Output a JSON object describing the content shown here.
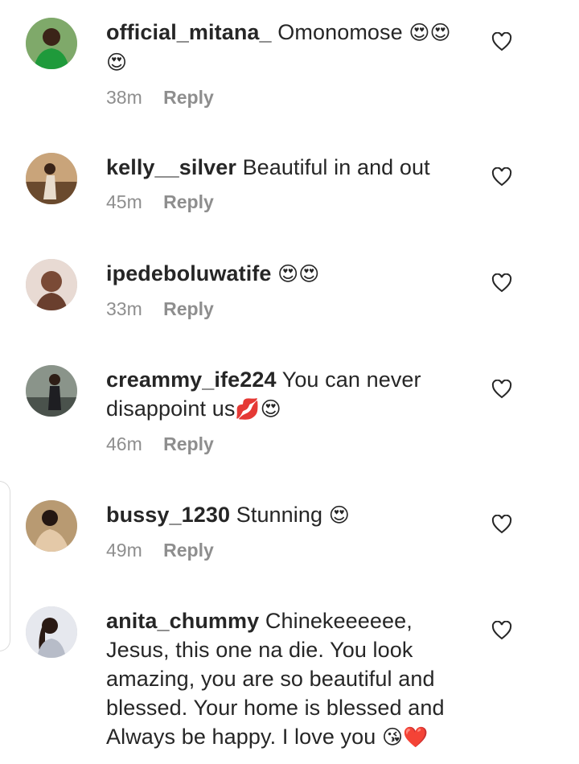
{
  "comments": [
    {
      "username": "official_mitana_",
      "text": "Omonomose",
      "emoji": "😍😍😍",
      "time": "38m",
      "reply": "Reply",
      "avatar_color": "#3a8f2e"
    },
    {
      "username": "kelly__silver",
      "text": "Beautiful in and out",
      "emoji": "",
      "time": "45m",
      "reply": "Reply",
      "avatar_color": "#8a6a50"
    },
    {
      "username": "ipedeboluwatife",
      "text": "",
      "emoji": "😍😍",
      "time": "33m",
      "reply": "Reply",
      "avatar_color": "#d9c2b8"
    },
    {
      "username": "creammy_ife224",
      "text": "You can never disappoint us",
      "emoji": "💋😍",
      "time": "46m",
      "reply": "Reply",
      "avatar_color": "#5f6a60"
    },
    {
      "username": "bussy_1230",
      "text": "Stunning",
      "emoji": "😍",
      "time": "49m",
      "reply": "Reply",
      "avatar_color": "#9c7a52"
    },
    {
      "username": "anita_chummy",
      "text": "Chinekeeeeee, Jesus, this one na die. You look amazing, you are so beautiful and blessed. Your home is blessed and Always be happy. I love you",
      "emoji": "😘❤️",
      "time": "",
      "reply": "",
      "avatar_color": "#cfd3dc"
    }
  ],
  "icons": {
    "like": "heart-outline-icon"
  }
}
